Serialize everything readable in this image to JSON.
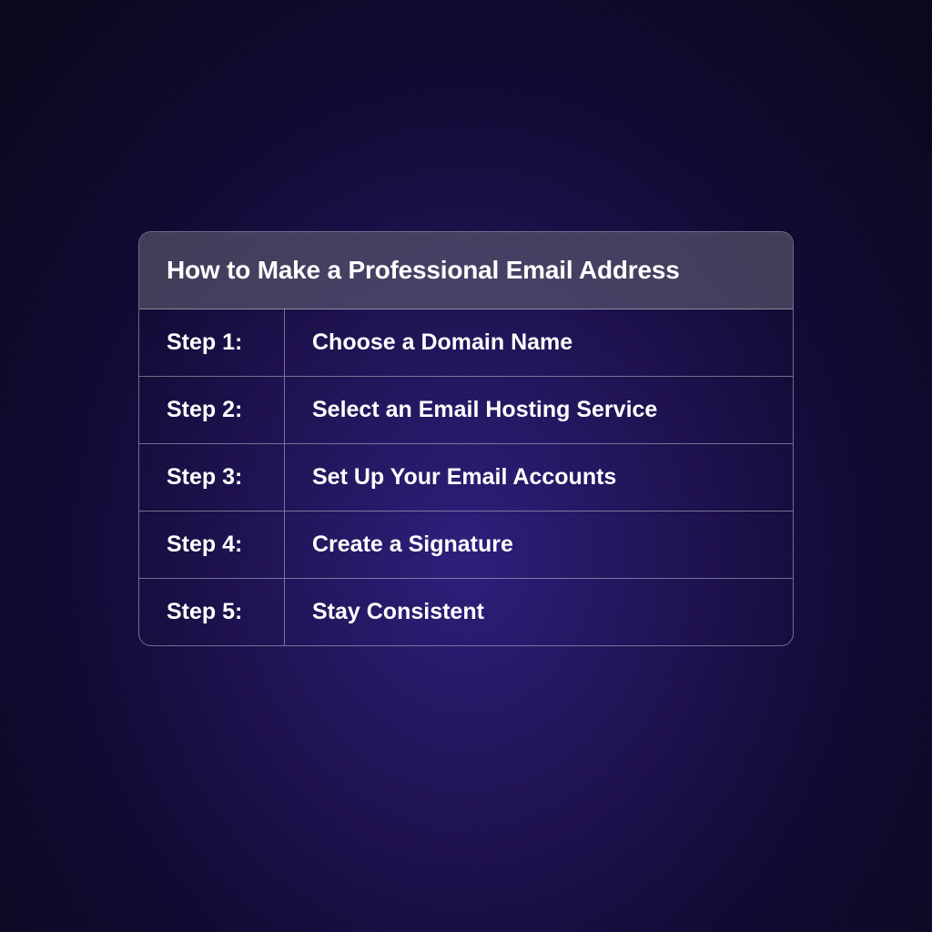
{
  "card": {
    "title": "How to Make a Professional Email Address",
    "steps": [
      {
        "label": "Step 1:",
        "desc": "Choose a Domain Name"
      },
      {
        "label": "Step 2:",
        "desc": "Select an Email Hosting Service"
      },
      {
        "label": "Step 3:",
        "desc": "Set Up Your Email Accounts"
      },
      {
        "label": "Step 4:",
        "desc": "Create a Signature"
      },
      {
        "label": "Step 5:",
        "desc": "Stay Consistent"
      }
    ]
  }
}
